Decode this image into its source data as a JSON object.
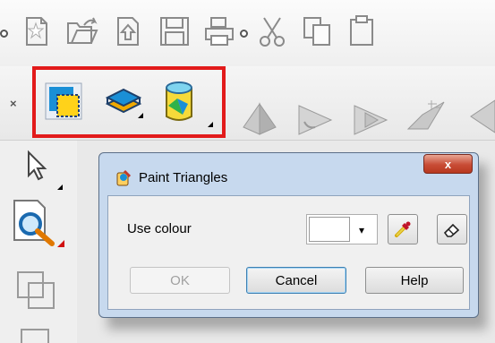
{
  "toolbar_top": {
    "icons": [
      "new-document-icon",
      "open-folder-icon",
      "import-icon",
      "save-icon",
      "print-icon",
      "cut-icon",
      "copy-icon",
      "paste-icon"
    ]
  },
  "toolbar_second": {
    "close_label": "×",
    "icons": [
      "paint-triangles-icon",
      "layers-icon",
      "cylinder-colour-icon",
      "pyramid-icon",
      "arrow-shape-icon",
      "arrow-shape-2-icon",
      "surface-icon",
      "wedge-icon"
    ]
  },
  "left_tools": [
    "select-arrow-icon",
    "zoom-magnifier-icon",
    "overlap-squares-icon",
    "frame-icon"
  ],
  "dialog": {
    "title": "Paint Triangles",
    "close_label": "x",
    "use_colour_label": "Use colour",
    "colour_value": "#ffffff",
    "dropdown_arrow": "▾",
    "ok_label": "OK",
    "cancel_label": "Cancel",
    "help_label": "Help"
  },
  "colors": {
    "highlight": "#e21a1a",
    "dialog_frame": "#c7d9ee",
    "close_button": "#c84c36"
  }
}
